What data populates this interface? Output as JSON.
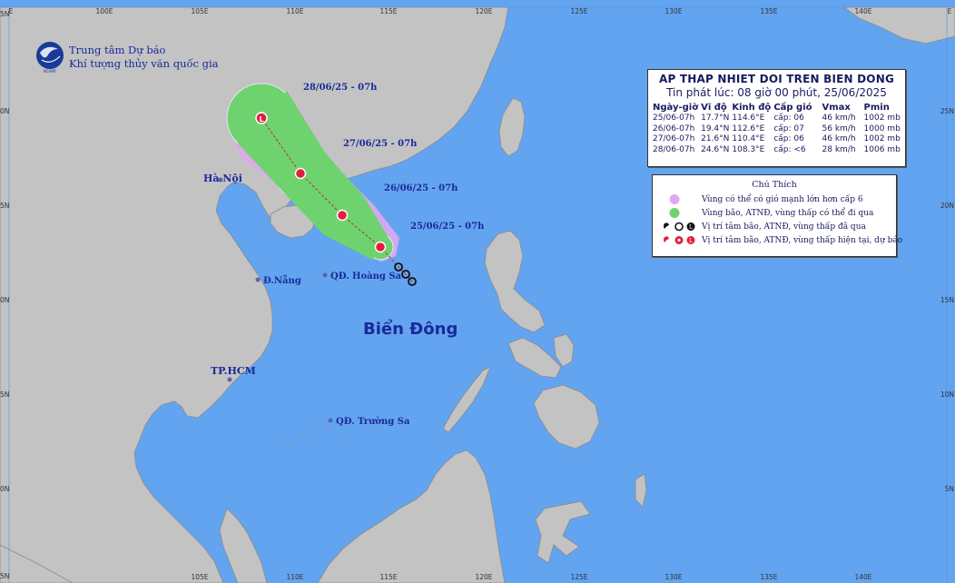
{
  "header": {
    "org_line1": "Trung tâm Dự báo",
    "org_line2": "Khí tượng thủy văn quốc gia",
    "logo_text": "NCHMF"
  },
  "map": {
    "sea_color": "#63a4f0",
    "land_color": "#c3c3c3",
    "top_lon_labels": [
      "E",
      "100E",
      "105E",
      "110E",
      "115E",
      "120E",
      "125E",
      "130E",
      "135E",
      "140E",
      "E"
    ],
    "bottom_lon_labels": [
      "105E",
      "110E",
      "115E",
      "120E",
      "125E",
      "130E",
      "135E",
      "140E"
    ],
    "lat_labels_left": [
      "5N",
      "0N",
      "5N",
      "0N",
      "5N",
      "0N",
      "5N"
    ],
    "lat_labels_right": [
      "25N",
      "20N",
      "15N",
      "10N",
      "5N"
    ],
    "sea_label": "Biển Đông",
    "places": {
      "hanoi": "Hà Nội",
      "danang": "Đ.Nẵng",
      "hoangsa": "QĐ. Hoàng Sa",
      "hcm": "TP.HCM",
      "truongsa": "QĐ. Trường Sa"
    },
    "forecast_labels": [
      "28/06/25 - 07h",
      "27/06/25 - 07h",
      "26/06/25 - 07h",
      "25/06/25 - 07h"
    ]
  },
  "info_box": {
    "title": "AP THAP NHIET DOI TREN BIEN DONG",
    "issued": "Tin phát lúc: 08 giờ 00 phút, 25/06/2025",
    "headers": [
      "Ngày-giờ",
      "Vĩ độ",
      "Kinh độ",
      "Cấp gió",
      "Vmax",
      "Pmin"
    ],
    "rows": [
      [
        "25/06-07h",
        "17.7°N",
        "114.6°E",
        "cấp: 06",
        "46 km/h",
        "1002 mb"
      ],
      [
        "26/06-07h",
        "19.4°N",
        "112.6°E",
        "cấp: 07",
        "56 km/h",
        "1000 mb"
      ],
      [
        "27/06-07h",
        "21.6°N",
        "110.4°E",
        "cấp: 06",
        "46 km/h",
        "1002 mb"
      ],
      [
        "28/06-07h",
        "24.6°N",
        "108.3°E",
        "cấp: <6",
        "28 km/h",
        "1006 mb"
      ]
    ]
  },
  "legend": {
    "title": "Chú Thích",
    "items": [
      "Vùng có thể có gió mạnh lớn hơn cấp 6",
      "Vùng bão, ATNĐ, vùng thấp có thể đi qua",
      "Vị trí tâm bão, ATNĐ, vùng thấp đã qua",
      "Vị trí tâm bão, ATNĐ, vùng thấp hiện tại, dự báo"
    ],
    "colors": {
      "strong_wind": "#e0a8f0",
      "cone": "#6ed36e",
      "past_track": "#111111",
      "forecast_track": "#e0203a"
    }
  }
}
